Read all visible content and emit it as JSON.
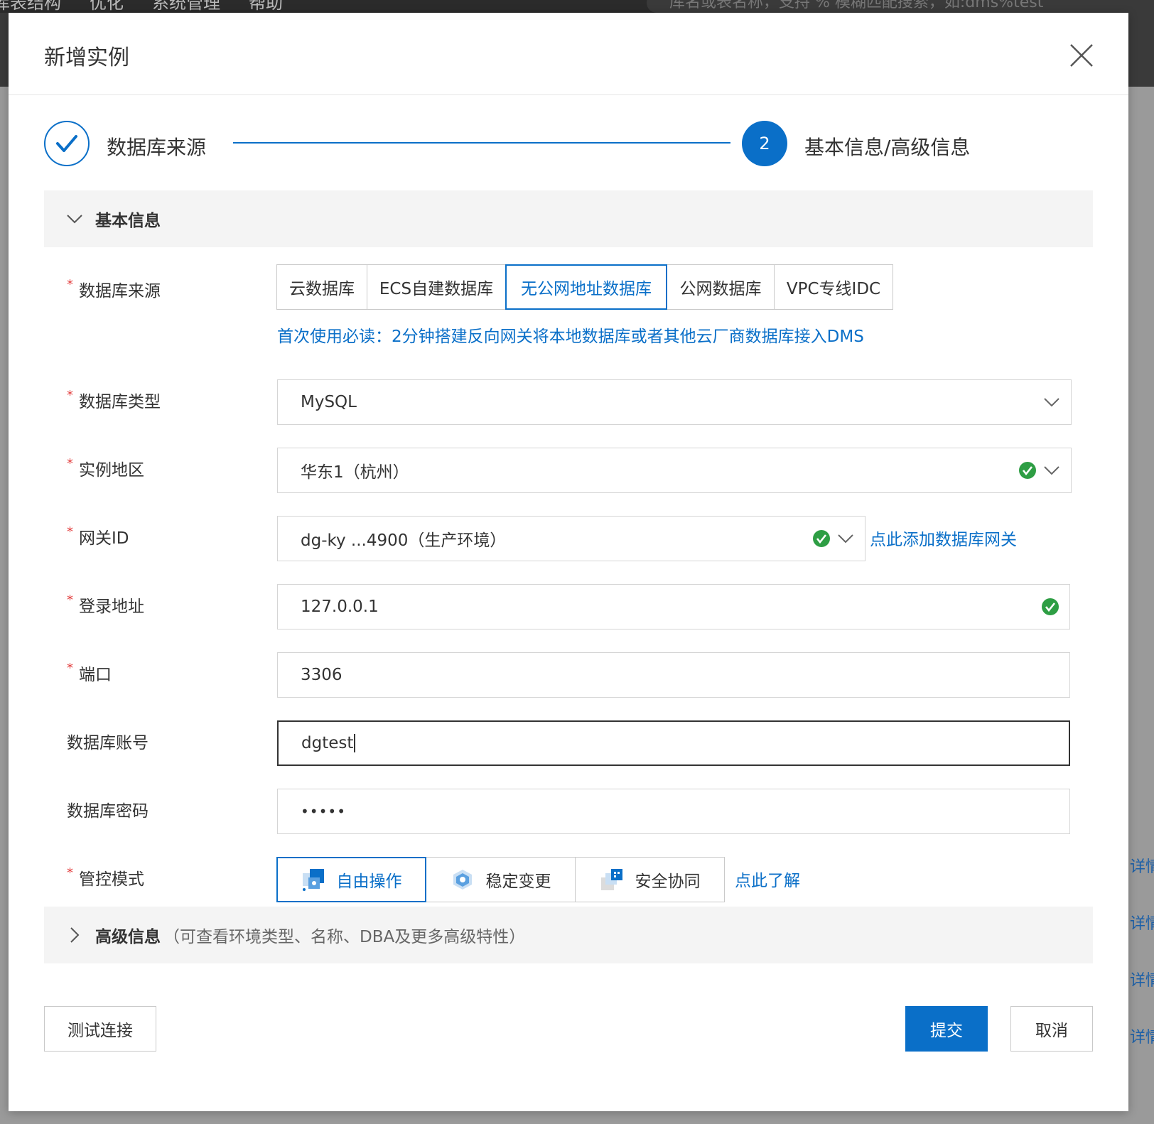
{
  "background": {
    "menu": [
      "库表结构",
      "优化",
      "系统管理",
      "帮助"
    ],
    "search_placeholder": "库名或表名称，支持 % 模糊匹配搜索，如:dms%test",
    "detail_links": [
      "详情",
      "详情",
      "详情",
      "详情"
    ]
  },
  "modal": {
    "title": "新增实例",
    "steps": [
      {
        "label": "数据库来源",
        "status": "done"
      },
      {
        "index": "2",
        "label": "基本信息/高级信息",
        "status": "current"
      }
    ],
    "basic_panel": {
      "title": "基本信息"
    },
    "advanced_panel": {
      "title": "高级信息",
      "subtitle": "（可查看环境类型、名称、DBA及更多高级特性）"
    },
    "form": {
      "source": {
        "label": "数据库来源",
        "options": [
          "云数据库",
          "ECS自建数据库",
          "无公网地址数据库",
          "公网数据库",
          "VPC专线IDC"
        ],
        "selected": "无公网地址数据库",
        "help_link": "首次使用必读：2分钟搭建反向网关将本地数据库或者其他云厂商数据库接入DMS"
      },
      "db_type": {
        "label": "数据库类型",
        "value": "MySQL"
      },
      "region": {
        "label": "实例地区",
        "value": "华东1（杭州）"
      },
      "gateway": {
        "label": "网关ID",
        "value": "dg-ky              ...4900（生产环境）",
        "add_link": "点此添加数据库网关"
      },
      "host": {
        "label": "登录地址",
        "value": "127.0.0.1"
      },
      "port": {
        "label": "端口",
        "value": "3306"
      },
      "account": {
        "label": "数据库账号",
        "value": "dgtest"
      },
      "password": {
        "label": "数据库密码",
        "value": "•••••"
      },
      "control_mode": {
        "label": "管控模式",
        "options": [
          "自由操作",
          "稳定变更",
          "安全协同"
        ],
        "selected": "自由操作",
        "learn_link": "点此了解"
      }
    },
    "buttons": {
      "test": "测试连接",
      "submit": "提交",
      "cancel": "取消"
    }
  },
  "colors": {
    "primary": "#0a6fc8",
    "required": "#e23b3b",
    "success": "#2e9e44"
  },
  "icons": [
    "close-icon",
    "check-icon",
    "chevron-down-icon",
    "chevron-right-icon",
    "success-check-icon"
  ]
}
